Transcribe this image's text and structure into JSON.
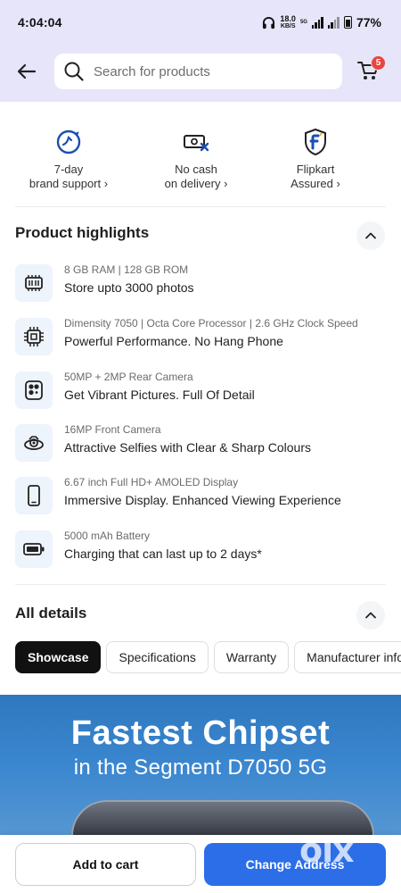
{
  "status_bar": {
    "time": "4:04:04",
    "net_speed_value": "18.0",
    "net_speed_unit": "KB/S",
    "network_type": "5G",
    "battery": "77%"
  },
  "header": {
    "search_placeholder": "Search for products",
    "cart_count": "5"
  },
  "assurances": [
    {
      "line1": "7-day",
      "line2": "brand support ›",
      "icon": "support-icon"
    },
    {
      "line1": "No cash",
      "line2": "on delivery ›",
      "icon": "no-cash-icon"
    },
    {
      "line1": "Flipkart",
      "line2": "Assured ›",
      "icon": "assured-shield-icon"
    }
  ],
  "highlights": {
    "title": "Product highlights",
    "items": [
      {
        "sub": "8 GB RAM | 128 GB ROM",
        "main": "Store upto 3000 photos",
        "icon": "memory-icon"
      },
      {
        "sub": "Dimensity 7050 | Octa Core Processor | 2.6 GHz Clock Speed",
        "main": "Powerful Performance. No Hang Phone",
        "icon": "processor-icon"
      },
      {
        "sub": "50MP + 2MP Rear Camera",
        "main": "Get Vibrant Pictures. Full Of Detail",
        "icon": "rear-camera-icon"
      },
      {
        "sub": "16MP Front Camera",
        "main": "Attractive Selfies with Clear & Sharp Colours",
        "icon": "front-camera-icon"
      },
      {
        "sub": "6.67 inch Full HD+ AMOLED Display",
        "main": "Immersive Display. Enhanced Viewing Experience",
        "icon": "display-icon"
      },
      {
        "sub": "5000 mAh Battery",
        "main": "Charging that can last up to 2 days*",
        "icon": "battery-icon"
      }
    ]
  },
  "details": {
    "title": "All details",
    "tabs": [
      "Showcase",
      "Specifications",
      "Warranty",
      "Manufacturer info"
    ],
    "active_tab": "Showcase"
  },
  "banner": {
    "headline": "Fastest Chipset",
    "subline": "in the Segment D7050 5G"
  },
  "actions": {
    "add_to_cart": "Add to cart",
    "change_address": "Change Address"
  },
  "watermark": "olx",
  "colors": {
    "header_bg": "#e7e5f9",
    "primary_button": "#2c6ee8",
    "badge": "#e8463c",
    "active_tab": "#111111",
    "highlight_icon_bg": "#eef4fb"
  }
}
